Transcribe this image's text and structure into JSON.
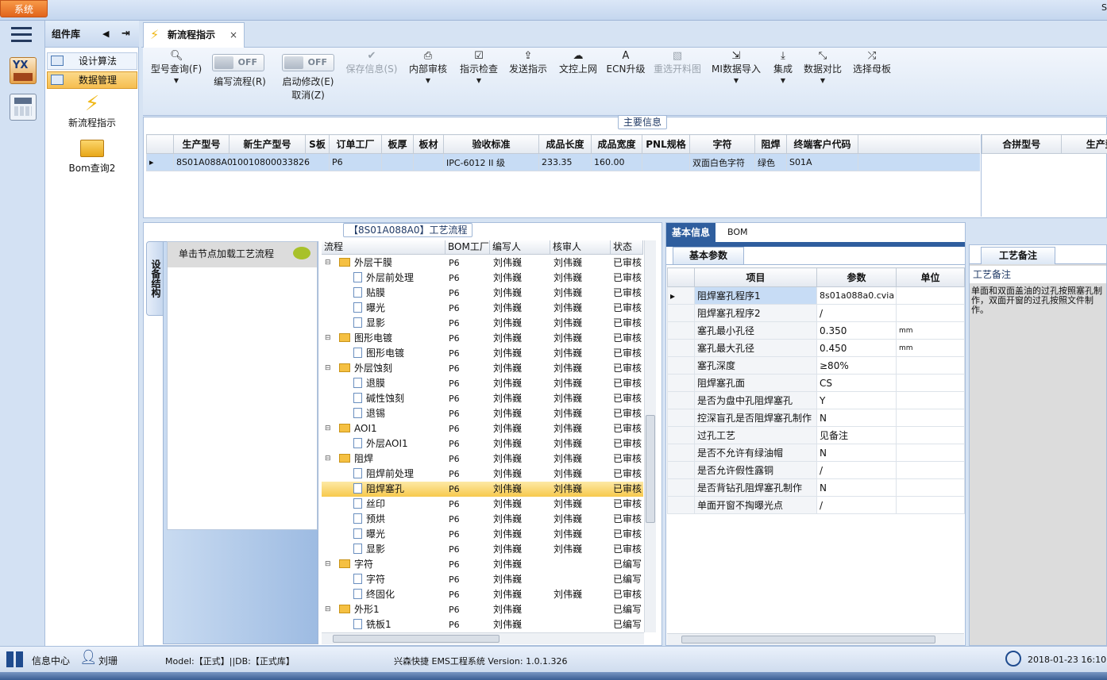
{
  "app": {
    "system_btn": "系统",
    "top_right": "S"
  },
  "sidebar": {
    "title": "组件库",
    "items": [
      {
        "label": "设计算法"
      },
      {
        "label": "数据管理"
      }
    ],
    "tiles": [
      {
        "label": "新流程指示"
      },
      {
        "label": "Bom查询2"
      }
    ],
    "rail_logo": "YX"
  },
  "tabs": {
    "active": "新流程指示"
  },
  "toolbar": {
    "model_query": "型号查询(F)",
    "toggle_off": "OFF",
    "edit_flow": "编写流程(R)",
    "enable_edit": "启动修改(E)",
    "cancel": "取消(Z)",
    "save_info": "保存信息(S)",
    "internal_review": "内部审核",
    "guide_check": "指示检查",
    "send_guide": "发送指示",
    "doc_upload": "文控上网",
    "ecn_upgrade": "ECN升级",
    "reselect_image": "重选开料图",
    "mi_import": "MI数据导入",
    "integrate": "集成",
    "data_compare": "数据对比",
    "select_mother": "选择母板"
  },
  "main_info": {
    "title": "主要信息",
    "columns": [
      "生产型号",
      "新生产型号",
      "S板",
      "订单工厂",
      "板厚",
      "板材",
      "验收标准",
      "成品长度",
      "成品宽度",
      "PNL规格",
      "字符",
      "阻焊",
      "终端客户代码"
    ],
    "row": [
      "8S01A088A0",
      "10010800033826",
      "",
      "P6",
      "",
      "",
      "IPC-6012 II 级",
      "233.35",
      "160.00",
      "",
      "双面白色字符",
      "绿色",
      "S01A"
    ],
    "side_columns": [
      "合拼型号",
      "生产型"
    ]
  },
  "process": {
    "title": "【8S01A088A0】工艺流程",
    "side_tab": "设备结构",
    "load_btn": "单击节点加载工艺流程",
    "headers": [
      "流程",
      "BOM工厂",
      "编写人",
      "核审人",
      "状态"
    ],
    "rows": [
      {
        "level": 0,
        "name": "外层干膜",
        "factory": "P6",
        "writer": "刘伟巍",
        "reviewer": "刘伟巍",
        "status": "已审核"
      },
      {
        "level": 1,
        "name": "外层前处理",
        "factory": "P6",
        "writer": "刘伟巍",
        "reviewer": "刘伟巍",
        "status": "已审核"
      },
      {
        "level": 1,
        "name": "贴膜",
        "factory": "P6",
        "writer": "刘伟巍",
        "reviewer": "刘伟巍",
        "status": "已审核"
      },
      {
        "level": 1,
        "name": "曝光",
        "factory": "P6",
        "writer": "刘伟巍",
        "reviewer": "刘伟巍",
        "status": "已审核"
      },
      {
        "level": 1,
        "name": "显影",
        "factory": "P6",
        "writer": "刘伟巍",
        "reviewer": "刘伟巍",
        "status": "已审核"
      },
      {
        "level": 0,
        "name": "图形电镀",
        "factory": "P6",
        "writer": "刘伟巍",
        "reviewer": "刘伟巍",
        "status": "已审核"
      },
      {
        "level": 1,
        "name": "图形电镀",
        "factory": "P6",
        "writer": "刘伟巍",
        "reviewer": "刘伟巍",
        "status": "已审核"
      },
      {
        "level": 0,
        "name": "外层蚀刻",
        "factory": "P6",
        "writer": "刘伟巍",
        "reviewer": "刘伟巍",
        "status": "已审核"
      },
      {
        "level": 1,
        "name": "退膜",
        "factory": "P6",
        "writer": "刘伟巍",
        "reviewer": "刘伟巍",
        "status": "已审核"
      },
      {
        "level": 1,
        "name": "碱性蚀刻",
        "factory": "P6",
        "writer": "刘伟巍",
        "reviewer": "刘伟巍",
        "status": "已审核"
      },
      {
        "level": 1,
        "name": "退锡",
        "factory": "P6",
        "writer": "刘伟巍",
        "reviewer": "刘伟巍",
        "status": "已审核"
      },
      {
        "level": 0,
        "name": "AOI1",
        "factory": "P6",
        "writer": "刘伟巍",
        "reviewer": "刘伟巍",
        "status": "已审核"
      },
      {
        "level": 1,
        "name": "外层AOI1",
        "factory": "P6",
        "writer": "刘伟巍",
        "reviewer": "刘伟巍",
        "status": "已审核"
      },
      {
        "level": 0,
        "name": "阻焊",
        "factory": "P6",
        "writer": "刘伟巍",
        "reviewer": "刘伟巍",
        "status": "已审核"
      },
      {
        "level": 1,
        "name": "阻焊前处理",
        "factory": "P6",
        "writer": "刘伟巍",
        "reviewer": "刘伟巍",
        "status": "已审核"
      },
      {
        "level": 1,
        "name": "阻焊塞孔",
        "factory": "P6",
        "writer": "刘伟巍",
        "reviewer": "刘伟巍",
        "status": "已审核",
        "selected": true
      },
      {
        "level": 1,
        "name": "丝印",
        "factory": "P6",
        "writer": "刘伟巍",
        "reviewer": "刘伟巍",
        "status": "已审核"
      },
      {
        "level": 1,
        "name": "预烘",
        "factory": "P6",
        "writer": "刘伟巍",
        "reviewer": "刘伟巍",
        "status": "已审核"
      },
      {
        "level": 1,
        "name": "曝光",
        "factory": "P6",
        "writer": "刘伟巍",
        "reviewer": "刘伟巍",
        "status": "已审核"
      },
      {
        "level": 1,
        "name": "显影",
        "factory": "P6",
        "writer": "刘伟巍",
        "reviewer": "刘伟巍",
        "status": "已审核"
      },
      {
        "level": 0,
        "name": "字符",
        "factory": "P6",
        "writer": "刘伟巍",
        "reviewer": "",
        "status": "已编写"
      },
      {
        "level": 1,
        "name": "字符",
        "factory": "P6",
        "writer": "刘伟巍",
        "reviewer": "",
        "status": "已编写"
      },
      {
        "level": 1,
        "name": "终固化",
        "factory": "P6",
        "writer": "刘伟巍",
        "reviewer": "刘伟巍",
        "status": "已审核"
      },
      {
        "level": 0,
        "name": "外形1",
        "factory": "P6",
        "writer": "刘伟巍",
        "reviewer": "",
        "status": "已编写"
      },
      {
        "level": 1,
        "name": "铣板1",
        "factory": "P6",
        "writer": "刘伟巍",
        "reviewer": "",
        "status": "已编写"
      }
    ]
  },
  "basic_info": {
    "tab_basic": "基本信息",
    "tab_bom": "BOM",
    "subtab": "基本参数",
    "headers": [
      "项目",
      "参数",
      "单位"
    ],
    "rows": [
      {
        "item": "阻焊塞孔程序1",
        "param": "8s01a088a0.cvia",
        "unit": ""
      },
      {
        "item": "阻焊塞孔程序2",
        "param": "/",
        "unit": ""
      },
      {
        "item": "塞孔最小孔径",
        "param": "0.350",
        "unit": "mm"
      },
      {
        "item": "塞孔最大孔径",
        "param": "0.450",
        "unit": "mm"
      },
      {
        "item": "塞孔深度",
        "param": "≥80%",
        "unit": ""
      },
      {
        "item": "阻焊塞孔面",
        "param": "CS",
        "unit": ""
      },
      {
        "item": "是否为盘中孔阻焊塞孔",
        "param": "Y",
        "unit": ""
      },
      {
        "item": "控深盲孔是否阻焊塞孔制作",
        "param": "N",
        "unit": ""
      },
      {
        "item": "过孔工艺",
        "param": "见备注",
        "unit": ""
      },
      {
        "item": "是否不允许有绿油帽",
        "param": "N",
        "unit": ""
      },
      {
        "item": "是否允许假性露铜",
        "param": "/",
        "unit": ""
      },
      {
        "item": "是否背钻孔阻焊塞孔制作",
        "param": "N",
        "unit": ""
      },
      {
        "item": "单面开窗不掏曝光点",
        "param": "/",
        "unit": ""
      }
    ]
  },
  "notes": {
    "tab": "工艺备注",
    "label": "工艺备注",
    "text": "单面和双面盖油的过孔按照塞孔制作，双面开窗的过孔按照文件制作。"
  },
  "status": {
    "info_center": "信息中心",
    "user": "刘珊",
    "model": "Model:【正式】||DB:【正式库】",
    "system": "兴森快捷 EMS工程系统 Version: 1.0.1.326",
    "datetime": "2018-01-23 16:10"
  }
}
